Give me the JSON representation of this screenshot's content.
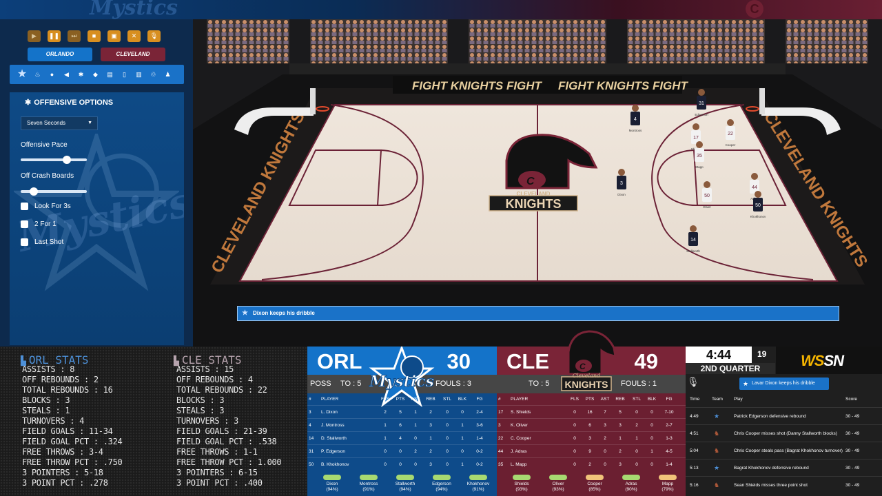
{
  "controls": {
    "buttons": [
      "play-icon",
      "pause-icon",
      "fast-forward-icon",
      "stop-icon",
      "timeout-icon",
      "substitution-icon",
      "microphone-icon"
    ],
    "teams": [
      "ORLANDO",
      "CLEVELAND"
    ]
  },
  "toolbar_icons": [
    "team-logo-icon",
    "fire-icon",
    "chat-icon",
    "megaphone-icon",
    "gear-icon",
    "shield-icon",
    "clipboard-icon",
    "document-icon",
    "chart-icon",
    "recycle-icon",
    "person-icon"
  ],
  "offensive_options": {
    "title": "OFFENSIVE OPTIONS",
    "select_value": "Seven Seconds",
    "pace_label": "Offensive Pace",
    "pace_value": 0.7,
    "crash_label": "Off Crash Boards",
    "crash_value": 0.2,
    "checkboxes": [
      "Look For 3s",
      "2 For 1",
      "Last Shot"
    ]
  },
  "court": {
    "banner_text": "FIGHT KNIGHTS FIGHT",
    "sideline_text": "CLEVELAND KNIGHTS",
    "logo_top": "CLEVELAND",
    "logo_bottom": "KNIGHTS",
    "logo_letter": "C",
    "players": [
      {
        "jersey": "4",
        "name": "Montross"
      },
      {
        "jersey": "31",
        "name": "Edgerson"
      },
      {
        "jersey": "17",
        "name": "Shields"
      },
      {
        "jersey": "22",
        "name": "Cooper"
      },
      {
        "jersey": "35",
        "name": "Mapp"
      },
      {
        "jersey": "3",
        "name": "Dixon"
      },
      {
        "jersey": "50",
        "name": "Oliver"
      },
      {
        "jersey": "44",
        "name": "Adras"
      },
      {
        "jersey": "50",
        "name": "Khokhonov"
      },
      {
        "jersey": "14",
        "name": "Stallworth"
      }
    ]
  },
  "play_banner": "Dixon keeps his dribble",
  "orl_stats": {
    "title": "ORL STATS",
    "lines": [
      "ASSISTS : 8",
      "OFF REBOUNDS : 2",
      "TOTAL REBOUNDS : 16",
      "BLOCKS : 3",
      "STEALS : 1",
      "TURNOVERS : 4",
      "FIELD GOALS : 11-34",
      "FIELD GOAL PCT : .324",
      "FREE THROWS : 3-4",
      "FREE THROW PCT : .750",
      "3 POINTERS : 5-18",
      "3 POINT PCT : .278"
    ]
  },
  "cle_stats": {
    "title": "CLE STATS",
    "lines": [
      "ASSISTS : 15",
      "OFF REBOUNDS : 4",
      "TOTAL REBOUNDS : 22",
      "BLOCKS : 3",
      "STEALS : 3",
      "TURNOVERS : 3",
      "FIELD GOALS : 21-39",
      "FIELD GOAL PCT : .538",
      "FREE THROWS : 1-1",
      "FREE THROW PCT : 1.000",
      "3 POINTERS : 6-15",
      "3 POINT PCT : .400"
    ]
  },
  "orl_box": {
    "abbr": "ORL",
    "score": "30",
    "poss": "POSS",
    "to": "TO : 5",
    "fouls": "FOULS : 3",
    "logo_text": "Mystics",
    "headers": [
      "#",
      "PLAYER",
      "FLS",
      "PTS",
      "AST",
      "REB",
      "STL",
      "BLK",
      "FG"
    ],
    "rows": [
      [
        "3",
        "L. Dixon",
        "2",
        "5",
        "1",
        "2",
        "0",
        "0",
        "2-4"
      ],
      [
        "4",
        "J. Montross",
        "1",
        "6",
        "1",
        "3",
        "0",
        "1",
        "3-6"
      ],
      [
        "14",
        "D. Stallworth",
        "1",
        "4",
        "0",
        "1",
        "0",
        "1",
        "1-4"
      ],
      [
        "31",
        "P. Edgerson",
        "0",
        "0",
        "2",
        "2",
        "0",
        "0",
        "0-2"
      ],
      [
        "50",
        "B. Khokhonov",
        "0",
        "0",
        "0",
        "3",
        "0",
        "1",
        "0-2"
      ]
    ],
    "energy": [
      {
        "name": "Dixon",
        "pct": "(94%)",
        "value": 94
      },
      {
        "name": "Montross",
        "pct": "(91%)",
        "value": 91
      },
      {
        "name": "Stallworth",
        "pct": "(94%)",
        "value": 94
      },
      {
        "name": "Edgerson",
        "pct": "(94%)",
        "value": 94
      },
      {
        "name": "Khokhonov",
        "pct": "(91%)",
        "value": 91
      }
    ]
  },
  "cle_box": {
    "abbr": "CLE",
    "score": "49",
    "to": "TO : 5",
    "fouls": "FOULS : 1",
    "logo_top": "Cleveland",
    "logo_bottom": "KNIGHTS",
    "headers": [
      "#",
      "PLAYER",
      "FLS",
      "PTS",
      "AST",
      "REB",
      "STL",
      "BLK",
      "FG"
    ],
    "rows": [
      [
        "17",
        "S. Shields",
        "0",
        "16",
        "7",
        "5",
        "0",
        "0",
        "7-10"
      ],
      [
        "3",
        "K. Oliver",
        "0",
        "6",
        "3",
        "3",
        "2",
        "0",
        "2-7"
      ],
      [
        "22",
        "C. Cooper",
        "0",
        "3",
        "2",
        "1",
        "1",
        "0",
        "1-3"
      ],
      [
        "44",
        "J. Adras",
        "0",
        "9",
        "0",
        "2",
        "0",
        "1",
        "4-5"
      ],
      [
        "35",
        "L. Mapp",
        "0",
        "2",
        "0",
        "3",
        "0",
        "0",
        "1-4"
      ]
    ],
    "energy": [
      {
        "name": "Shields",
        "pct": "(93%)",
        "value": 93
      },
      {
        "name": "Oliver",
        "pct": "(93%)",
        "value": 93
      },
      {
        "name": "Cooper",
        "pct": "(85%)",
        "value": 85
      },
      {
        "name": "Adras",
        "pct": "(90%)",
        "value": 90
      },
      {
        "name": "Mapp",
        "pct": "(79%)",
        "value": 79
      }
    ]
  },
  "game_info": {
    "clock": "4:44",
    "shot_clock": "19",
    "quarter": "2ND QUARTER",
    "network_ws": "WS",
    "network_sn": "SN",
    "bubble": "Lavar Dixon keeps his dribble",
    "headers": [
      "Time",
      "Team",
      "Play",
      "Score"
    ],
    "plays": [
      {
        "time": "4:49",
        "team": "orl",
        "play": "Patrick Edgerson defensive rebound",
        "score": "30 - 49"
      },
      {
        "time": "4:51",
        "team": "cle",
        "play": "Chris Cooper misses shot (Danny Stallworth blocks)",
        "score": "30 - 49"
      },
      {
        "time": "5:04",
        "team": "cle",
        "play": "Chris Cooper steals pass (Bagrat Khokhonov turnover)",
        "score": "30 - 49"
      },
      {
        "time": "5:13",
        "team": "orl",
        "play": "Bagrat Khokhonov defensive rebound",
        "score": "30 - 49"
      },
      {
        "time": "5:16",
        "team": "cle",
        "play": "Sean Shields misses three point shot",
        "score": "30 - 49"
      }
    ]
  },
  "colors": {
    "orl_primary": "#1473c9",
    "cle_primary": "#7a2437",
    "accent_orange": "#d88f20",
    "energy_green": "#a7d971",
    "energy_amber": "#f0c37a"
  }
}
